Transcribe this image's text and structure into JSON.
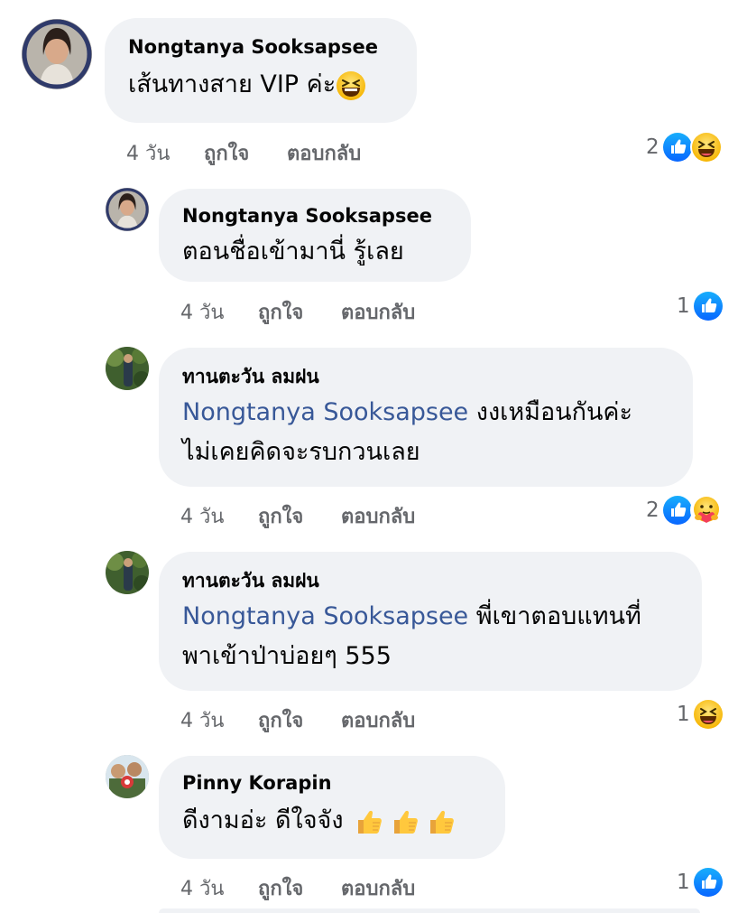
{
  "comments": [
    {
      "author": "Nongtanya Sooksapsee",
      "text": "เส้นทางสาย VIP ค่ะ",
      "time": "4 วัน",
      "like_label": "ถูกใจ",
      "reply_label": "ตอบกลับ",
      "reaction_count": "2",
      "reactions": [
        "like-icon",
        "haha-icon"
      ]
    },
    {
      "author": "Nongtanya Sooksapsee",
      "text": "ตอนชื่อเข้ามานี่ รู้เลย",
      "time": "4 วัน",
      "like_label": "ถูกใจ",
      "reply_label": "ตอบกลับ",
      "reaction_count": "1",
      "reactions": [
        "like-icon"
      ]
    },
    {
      "author": "ทานตะวัน ลมฝน",
      "mention": "Nongtanya Sooksapsee",
      "text_line1": "งงเหมือนกันค่ะ",
      "text_line2": "ไม่เคยคิดจะรบกวนเลย",
      "time": "4 วัน",
      "like_label": "ถูกใจ",
      "reply_label": "ตอบกลับ",
      "reaction_count": "2",
      "reactions": [
        "like-icon",
        "care-icon"
      ]
    },
    {
      "author": "ทานตะวัน ลมฝน",
      "mention": "Nongtanya Sooksapsee",
      "text_line1": "พี่เขาตอบแทนที่",
      "text_line2": "พาเข้าป่าบ่อยๆ 555",
      "time": "4 วัน",
      "like_label": "ถูกใจ",
      "reply_label": "ตอบกลับ",
      "reaction_count": "1",
      "reactions": [
        "haha-icon"
      ]
    },
    {
      "author": "Pinny Korapin",
      "text": "ดีงามอ่ะ ดีใจจัง",
      "time": "4 วัน",
      "like_label": "ถูกใจ",
      "reply_label": "ตอบกลับ",
      "reaction_count": "1",
      "reactions": [
        "like-icon"
      ]
    }
  ],
  "colors": {
    "bubble": "#f0f2f5",
    "mention": "#385898",
    "meta": "#65676b",
    "like_blue": "#1877f2"
  }
}
